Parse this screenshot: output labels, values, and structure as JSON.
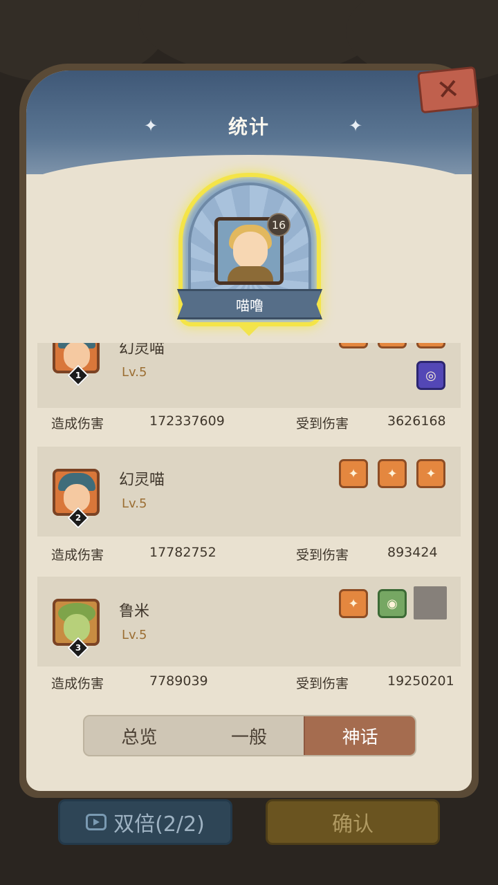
{
  "title": "统计",
  "close_icon": "close-icon",
  "hero": {
    "name": "喵噜",
    "level": "16"
  },
  "heroes": [
    {
      "name": "幻灵喵",
      "level": "Lv.5",
      "rank": "1",
      "items": [
        "item-orange",
        "item-orange",
        "item-orange",
        "item-purple"
      ],
      "dealt_label": "造成伤害",
      "dealt": "172337609",
      "taken_label": "受到伤害",
      "taken": "3626168"
    },
    {
      "name": "幻灵喵",
      "level": "Lv.5",
      "rank": "2",
      "items": [
        "item-orange",
        "item-orange",
        "item-orange"
      ],
      "dealt_label": "造成伤害",
      "dealt": "17782752",
      "taken_label": "受到伤害",
      "taken": "893424"
    },
    {
      "name": "鲁米",
      "level": "Lv.5",
      "rank": "3",
      "items": [
        "item-orange",
        "item-green",
        "empty-slot"
      ],
      "dealt_label": "造成伤害",
      "dealt": "7789039",
      "taken_label": "受到伤害",
      "taken": "19250201"
    }
  ],
  "tabs": [
    {
      "label": "总览",
      "active": false
    },
    {
      "label": "一般",
      "active": false
    },
    {
      "label": "神话",
      "active": true
    }
  ],
  "buttons": {
    "double": "双倍(2/2)",
    "confirm": "确认"
  },
  "colors": {
    "accent": "#a56c4f",
    "glow": "#f4e448",
    "header": "#4f6a88"
  }
}
